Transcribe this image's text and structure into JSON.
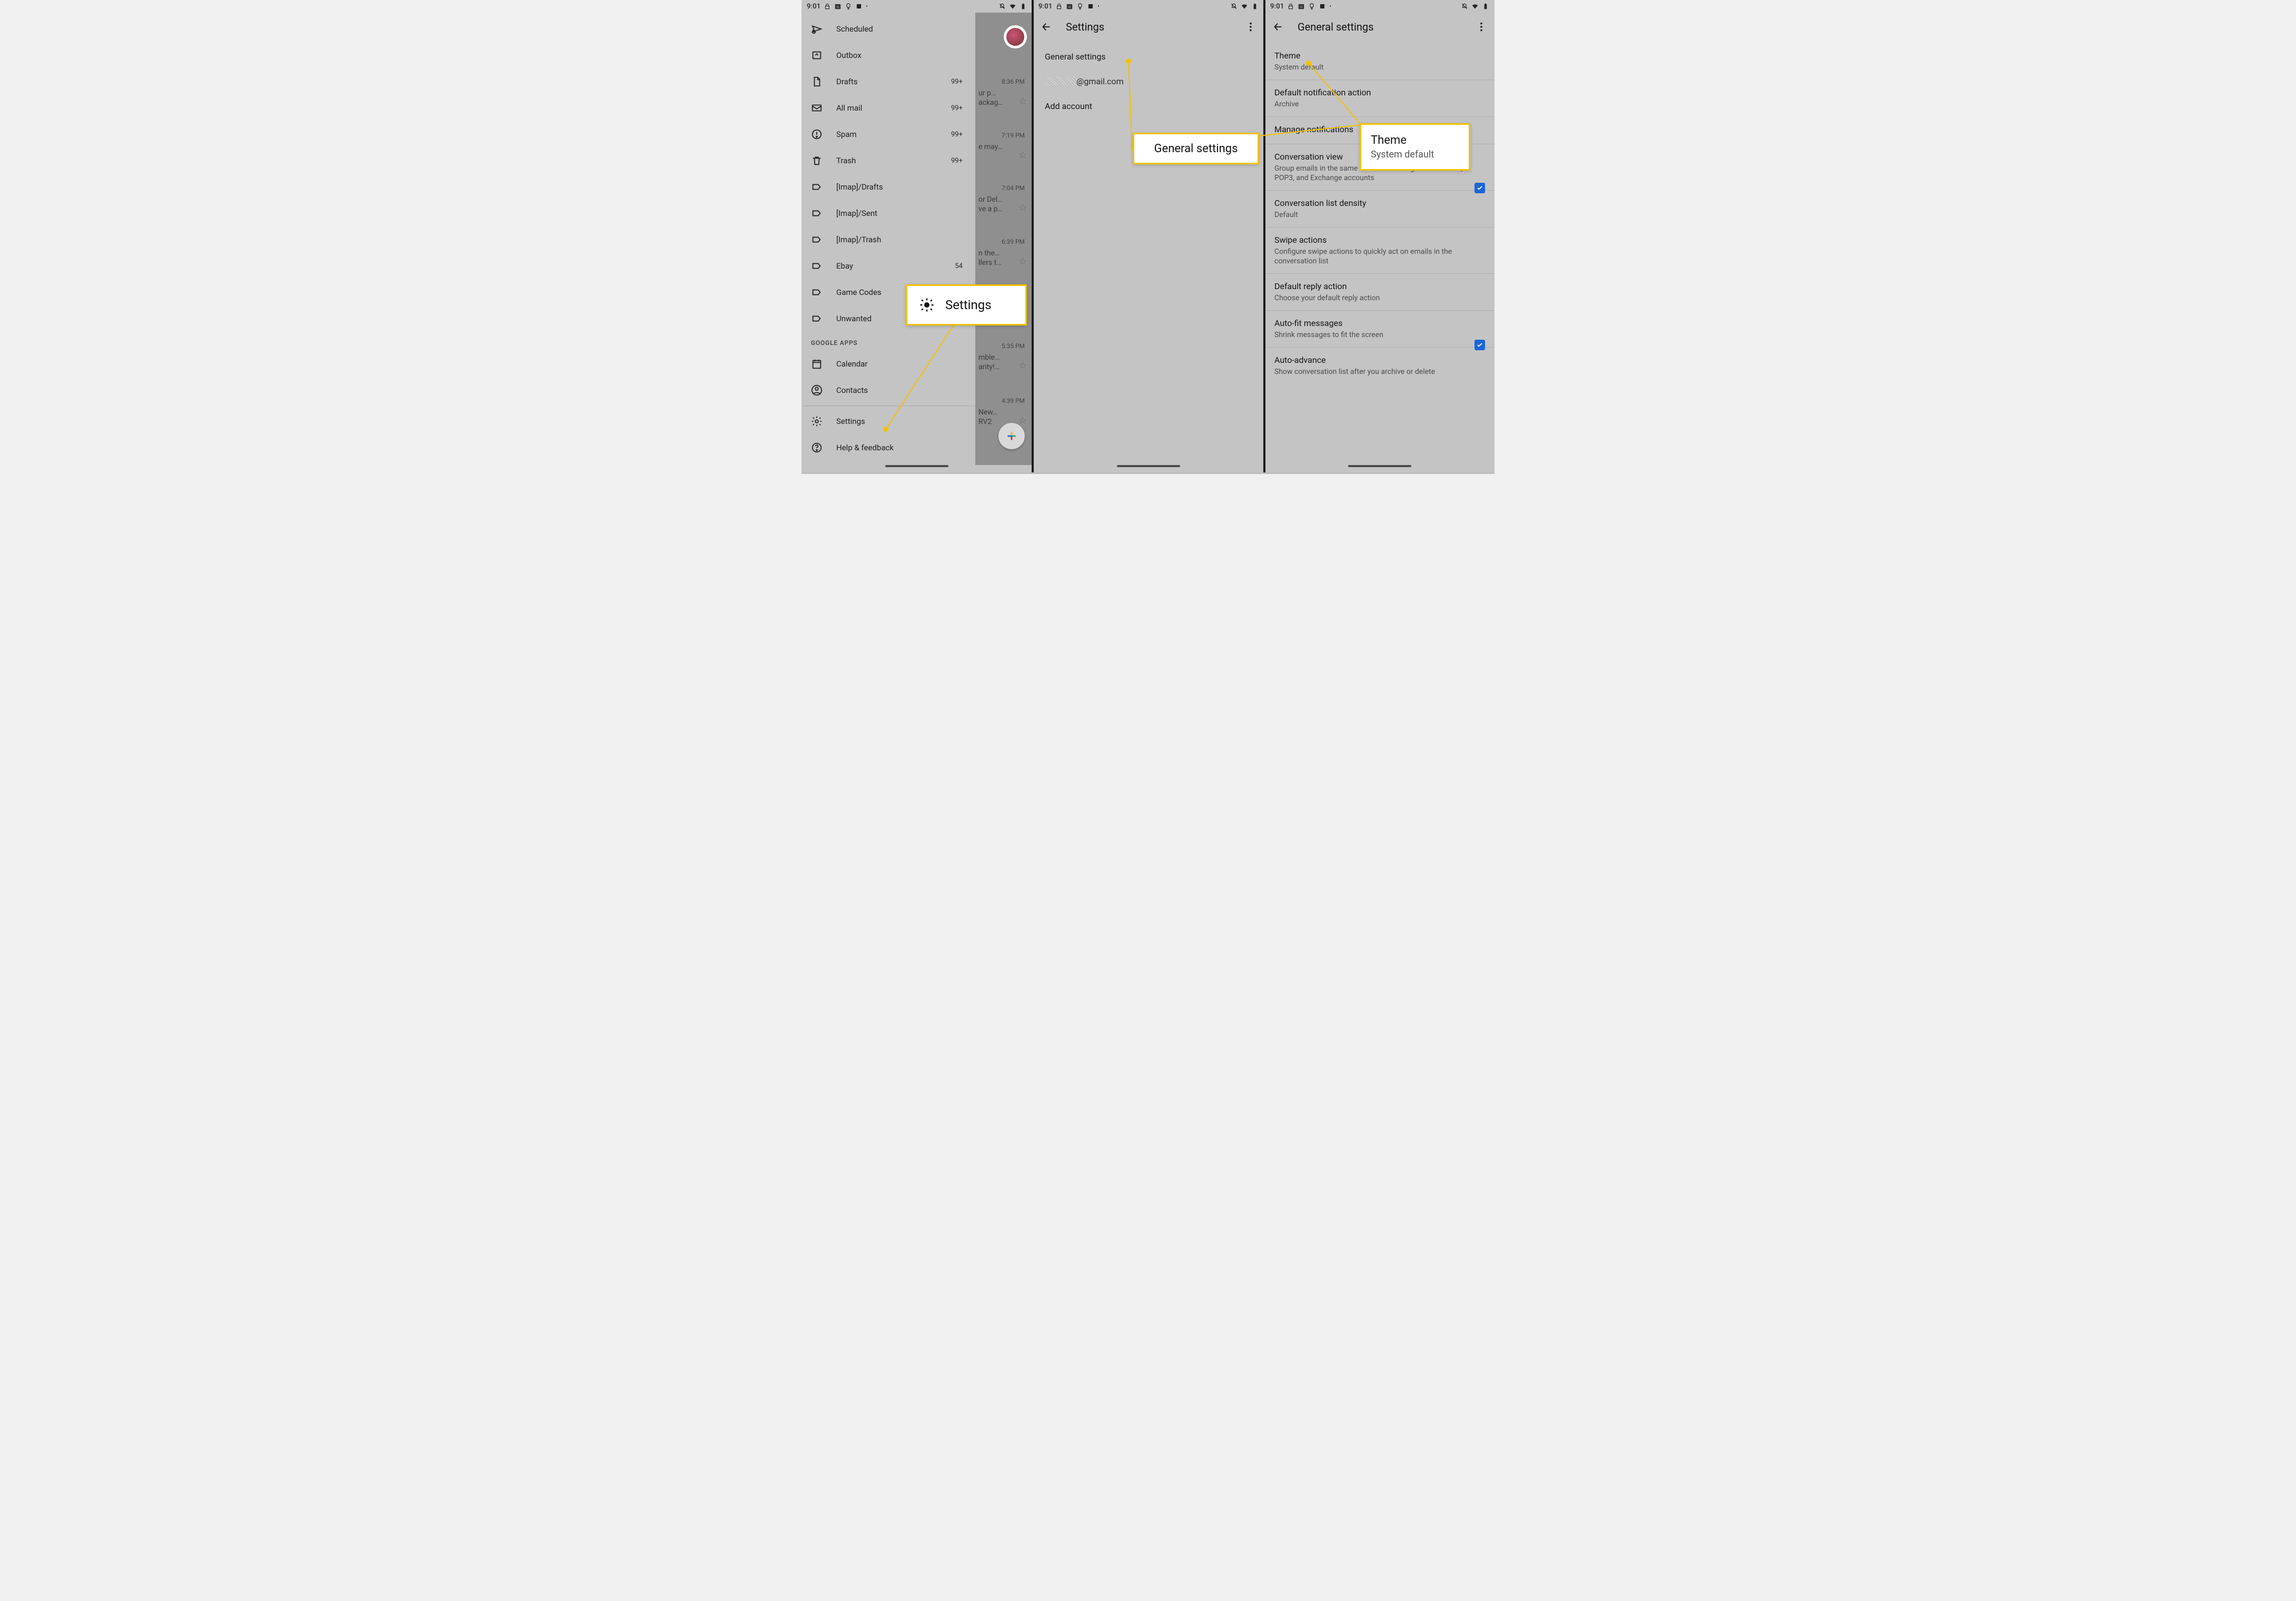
{
  "status": {
    "time": "9:01",
    "icons_left": [
      "lock-icon",
      "calendar31-icon",
      "bulb-icon",
      "square-icon",
      "dot"
    ],
    "icons_right": [
      "bell-off-icon",
      "wifi-icon",
      "battery-icon"
    ]
  },
  "colors": {
    "annotation_yellow": "#f2c200",
    "checkbox_blue": "#1a66d6"
  },
  "phone1": {
    "drawer": {
      "items": [
        {
          "icon": "scheduled-icon",
          "label": "Scheduled",
          "count": ""
        },
        {
          "icon": "outbox-icon",
          "label": "Outbox",
          "count": ""
        },
        {
          "icon": "drafts-icon",
          "label": "Drafts",
          "count": "99+"
        },
        {
          "icon": "allmail-icon",
          "label": "All mail",
          "count": "99+"
        },
        {
          "icon": "spam-icon",
          "label": "Spam",
          "count": "99+"
        },
        {
          "icon": "trash-icon",
          "label": "Trash",
          "count": "99+"
        },
        {
          "icon": "label-icon",
          "label": "[Imap]/Drafts",
          "count": ""
        },
        {
          "icon": "label-icon",
          "label": "[Imap]/Sent",
          "count": ""
        },
        {
          "icon": "label-icon",
          "label": "[Imap]/Trash",
          "count": ""
        },
        {
          "icon": "label-icon",
          "label": "Ebay",
          "count": "54"
        },
        {
          "icon": "label-icon",
          "label": "Game Codes",
          "count": ""
        },
        {
          "icon": "label-icon",
          "label": "Unwanted",
          "count": ""
        }
      ],
      "section_label": "GOOGLE APPS",
      "apps": [
        {
          "icon": "calendar-icon",
          "label": "Calendar"
        },
        {
          "icon": "contacts-icon",
          "label": "Contacts"
        }
      ],
      "footer": [
        {
          "icon": "gear-icon",
          "label": "Settings"
        },
        {
          "icon": "help-icon",
          "label": "Help & feedback"
        }
      ]
    },
    "bg_emails": [
      {
        "time": "8:36 PM",
        "line1": "ur p…",
        "line2": "ackag…"
      },
      {
        "time": "7:19 PM",
        "line1": "e may…",
        "line2": ""
      },
      {
        "time": "7:04 PM",
        "line1": "or Del…",
        "line2": "ve a p…"
      },
      {
        "time": "6:39 PM",
        "line1": "n the…",
        "line2": "llers t…"
      },
      {
        "time": "5:35 PM",
        "line1": "mble…",
        "line2": "arity!…"
      },
      {
        "time": "4:39 PM",
        "line1": "New…",
        "line2": "RV2"
      }
    ]
  },
  "phone2": {
    "appbar": {
      "title": "Settings"
    },
    "items": {
      "general": "General settings",
      "email_suffix": "@gmail.com",
      "add_account": "Add account"
    }
  },
  "phone3": {
    "appbar": {
      "title": "General settings"
    },
    "rows": [
      {
        "title": "Theme",
        "sub": "System default"
      },
      {
        "title": "Default notification action",
        "sub": "Archive"
      },
      {
        "title": "Manage notifications",
        "sub": ""
      },
      {
        "title": "Conversation view",
        "sub": "Group emails in the same conversation together for IMAP, POP3, and Exchange accounts",
        "checked": true
      },
      {
        "title": "Conversation list density",
        "sub": "Default"
      },
      {
        "title": "Swipe actions",
        "sub": "Configure swipe actions to quickly act on emails in the conversation list"
      },
      {
        "title": "Default reply action",
        "sub": "Choose your default reply action"
      },
      {
        "title": "Auto-fit messages",
        "sub": "Shrink messages to fit the screen",
        "checked": true
      },
      {
        "title": "Auto-advance",
        "sub": "Show conversation list after you archive or delete"
      }
    ]
  },
  "callouts": {
    "c1": {
      "label": "Settings"
    },
    "c2": {
      "label": "General settings"
    },
    "c3": {
      "title": "Theme",
      "sub": "System default"
    }
  }
}
